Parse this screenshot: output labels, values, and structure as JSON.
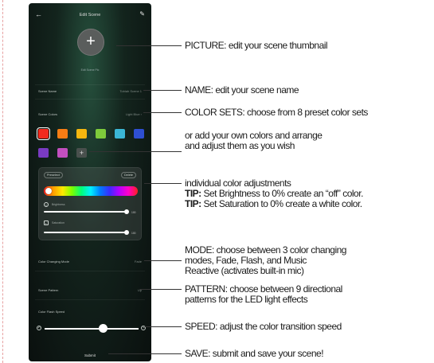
{
  "phone": {
    "title": "Edit Scene",
    "back_icon": "arrow-left-icon",
    "edit_icon": "pencil-icon",
    "picture_add_glyph": "+",
    "picture_caption": "Edit Scene Pic",
    "name_label": "Scene Name",
    "name_value": "Tobiah Scene 1",
    "colors_label": "Scene Colors",
    "colors_value": "Light Blue ›",
    "swatches": [
      "#f22a1d",
      "#f77d14",
      "#f5b70f",
      "#7ecb3b",
      "#3bb7d6",
      "#2e4fd2",
      "#7a3bc2",
      "#c24fbf"
    ],
    "add_color_glyph": "+",
    "tab_left": "Preselect",
    "tab_right": "Delete",
    "brightness_label": "Brightness",
    "saturation_label": "Saturation",
    "brightness_pct": "100",
    "saturation_pct": "100",
    "mode_label": "Color Changing Mode",
    "mode_value": "Fade",
    "pattern_label": "Scene Pattern",
    "pattern_value": "Up",
    "speed_label": "Color Flash Speed",
    "speed_level": 0.62,
    "submit_label": "Submit"
  },
  "annotations": {
    "picture": "PICTURE: edit your scene thumbnail",
    "name": "NAME: edit your scene name",
    "color_sets": "COLOR SETS: choose from 8 preset color sets",
    "add_colors_1": "or add your own colors and arrange",
    "add_colors_2": "and adjust them as you wish",
    "adjust": "individual color adjustments",
    "tip_label": "TIP:",
    "tip1_text": " Set Brightness to 0% create an “off” color.",
    "tip2_text": " Set Saturation to 0% create a white color.",
    "mode_1": "MODE: choose between 3 color changing",
    "mode_2": "modes, Fade, Flash, and Music",
    "mode_3": "Reactive (activates built-in mic)",
    "pattern_1": "PATTERN: choose between 9 directional",
    "pattern_2": "patterns for the LED light effects",
    "speed": "SPEED: adjust the color transition speed",
    "save": "SAVE: submit and save your scene!"
  }
}
